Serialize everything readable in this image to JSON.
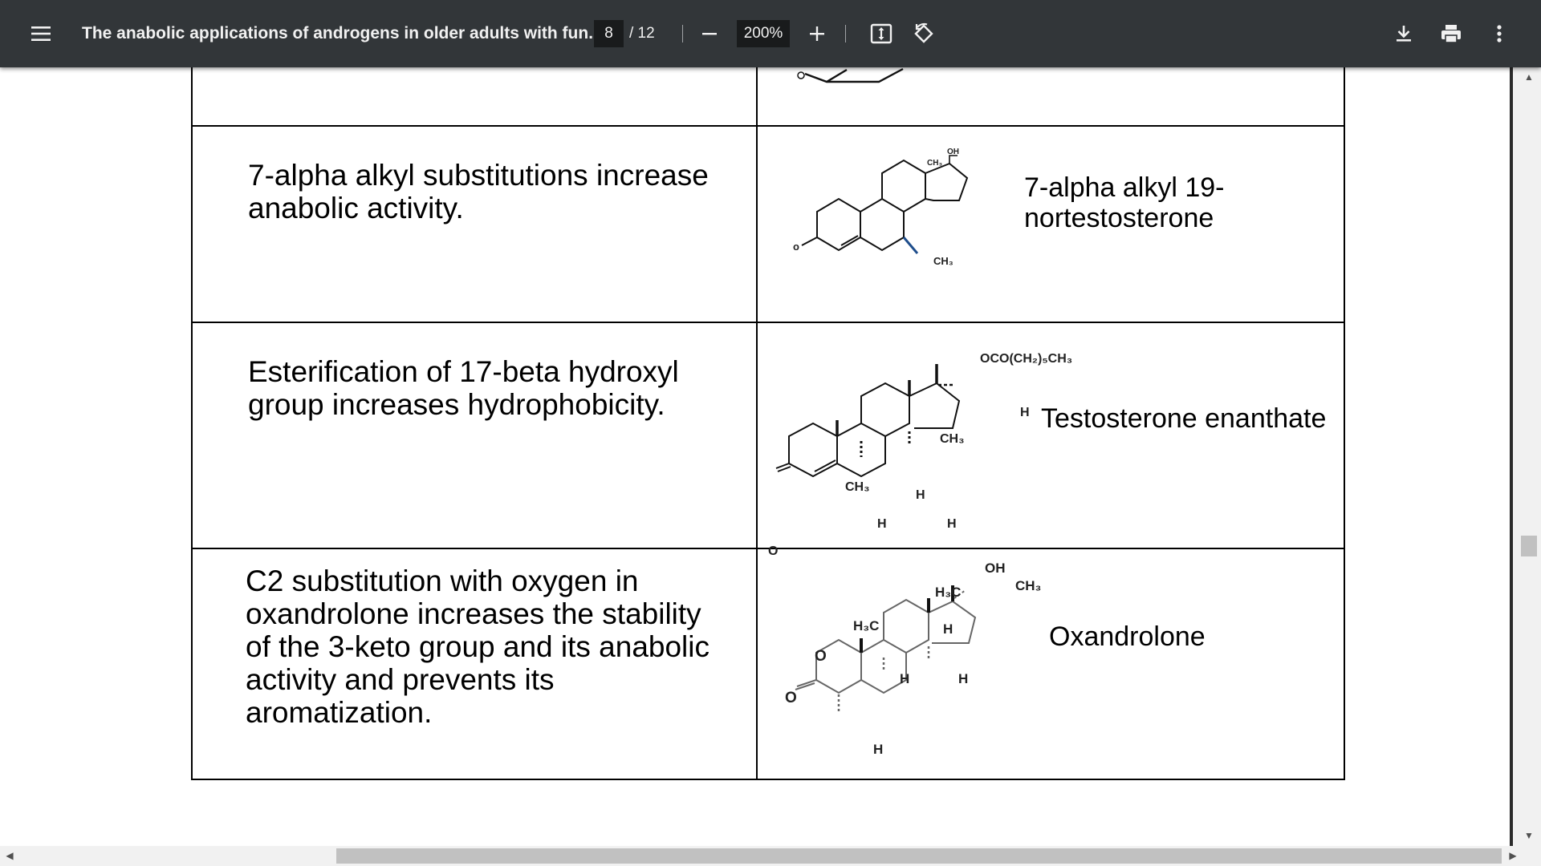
{
  "toolbar": {
    "menu_icon": "menu-icon",
    "title": "The anabolic applications of androgens in older adults with fun...",
    "page_current": "8",
    "page_total": "/ 12",
    "zoom_out_icon": "minus-icon",
    "zoom_value": "200%",
    "zoom_in_icon": "plus-icon",
    "fit_icon": "fit-to-page-icon",
    "rotate_icon": "rotate-icon",
    "download_icon": "download-icon",
    "print_icon": "print-icon",
    "more_icon": "more-vertical-icon"
  },
  "document": {
    "rows": [
      {
        "description": "7-alpha alkyl substitutions increase anabolic activity.",
        "label": "7-alpha alkyl 19-nortestosterone",
        "structure_text": [
          "OH",
          "CH₃",
          "CH₃",
          "o"
        ]
      },
      {
        "description": "Esterification of 17-beta hydroxyl group increases hydrophobicity.",
        "label": "Testosterone enanthate",
        "structure_text": [
          "OCO(CH₂)₅CH₃",
          "CH₃",
          "H",
          "CH₃",
          "H",
          "H",
          "H",
          "O"
        ]
      },
      {
        "description": "C2 substitution with oxygen in oxandrolone increases the stability of the 3-keto group and its anabolic activity and prevents its aromatization.",
        "label": "Oxandrolone",
        "structure_text": [
          "OH",
          "H₃C",
          "CH₃",
          "H₃C",
          "H",
          "H",
          "H",
          "H",
          "O",
          "O"
        ]
      }
    ]
  },
  "scrollbars": {
    "vertical_icon_up": "arrow-up-icon",
    "vertical_icon_down": "arrow-down-icon",
    "horizontal_icon_left": "arrow-left-icon",
    "horizontal_icon_right": "arrow-right-icon",
    "glyph_up": "▲",
    "glyph_down": "▼",
    "glyph_left": "◀",
    "glyph_right": "▶"
  },
  "colors": {
    "toolbar_bg": "#323639",
    "toolbar_text": "#f1f1f1",
    "input_bg": "#191b1c",
    "substituent_bond": "#1f4e8c"
  }
}
